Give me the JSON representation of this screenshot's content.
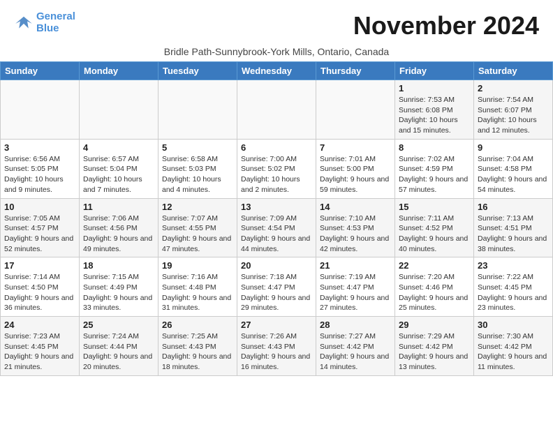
{
  "logo": {
    "text1": "General",
    "text2": "Blue"
  },
  "title": "November 2024",
  "location": "Bridle Path-Sunnybrook-York Mills, Ontario, Canada",
  "weekdays": [
    "Sunday",
    "Monday",
    "Tuesday",
    "Wednesday",
    "Thursday",
    "Friday",
    "Saturday"
  ],
  "weeks": [
    [
      {
        "day": "",
        "info": ""
      },
      {
        "day": "",
        "info": ""
      },
      {
        "day": "",
        "info": ""
      },
      {
        "day": "",
        "info": ""
      },
      {
        "day": "",
        "info": ""
      },
      {
        "day": "1",
        "info": "Sunrise: 7:53 AM\nSunset: 6:08 PM\nDaylight: 10 hours and 15 minutes."
      },
      {
        "day": "2",
        "info": "Sunrise: 7:54 AM\nSunset: 6:07 PM\nDaylight: 10 hours and 12 minutes."
      }
    ],
    [
      {
        "day": "3",
        "info": "Sunrise: 6:56 AM\nSunset: 5:05 PM\nDaylight: 10 hours and 9 minutes."
      },
      {
        "day": "4",
        "info": "Sunrise: 6:57 AM\nSunset: 5:04 PM\nDaylight: 10 hours and 7 minutes."
      },
      {
        "day": "5",
        "info": "Sunrise: 6:58 AM\nSunset: 5:03 PM\nDaylight: 10 hours and 4 minutes."
      },
      {
        "day": "6",
        "info": "Sunrise: 7:00 AM\nSunset: 5:02 PM\nDaylight: 10 hours and 2 minutes."
      },
      {
        "day": "7",
        "info": "Sunrise: 7:01 AM\nSunset: 5:00 PM\nDaylight: 9 hours and 59 minutes."
      },
      {
        "day": "8",
        "info": "Sunrise: 7:02 AM\nSunset: 4:59 PM\nDaylight: 9 hours and 57 minutes."
      },
      {
        "day": "9",
        "info": "Sunrise: 7:04 AM\nSunset: 4:58 PM\nDaylight: 9 hours and 54 minutes."
      }
    ],
    [
      {
        "day": "10",
        "info": "Sunrise: 7:05 AM\nSunset: 4:57 PM\nDaylight: 9 hours and 52 minutes."
      },
      {
        "day": "11",
        "info": "Sunrise: 7:06 AM\nSunset: 4:56 PM\nDaylight: 9 hours and 49 minutes."
      },
      {
        "day": "12",
        "info": "Sunrise: 7:07 AM\nSunset: 4:55 PM\nDaylight: 9 hours and 47 minutes."
      },
      {
        "day": "13",
        "info": "Sunrise: 7:09 AM\nSunset: 4:54 PM\nDaylight: 9 hours and 44 minutes."
      },
      {
        "day": "14",
        "info": "Sunrise: 7:10 AM\nSunset: 4:53 PM\nDaylight: 9 hours and 42 minutes."
      },
      {
        "day": "15",
        "info": "Sunrise: 7:11 AM\nSunset: 4:52 PM\nDaylight: 9 hours and 40 minutes."
      },
      {
        "day": "16",
        "info": "Sunrise: 7:13 AM\nSunset: 4:51 PM\nDaylight: 9 hours and 38 minutes."
      }
    ],
    [
      {
        "day": "17",
        "info": "Sunrise: 7:14 AM\nSunset: 4:50 PM\nDaylight: 9 hours and 36 minutes."
      },
      {
        "day": "18",
        "info": "Sunrise: 7:15 AM\nSunset: 4:49 PM\nDaylight: 9 hours and 33 minutes."
      },
      {
        "day": "19",
        "info": "Sunrise: 7:16 AM\nSunset: 4:48 PM\nDaylight: 9 hours and 31 minutes."
      },
      {
        "day": "20",
        "info": "Sunrise: 7:18 AM\nSunset: 4:47 PM\nDaylight: 9 hours and 29 minutes."
      },
      {
        "day": "21",
        "info": "Sunrise: 7:19 AM\nSunset: 4:47 PM\nDaylight: 9 hours and 27 minutes."
      },
      {
        "day": "22",
        "info": "Sunrise: 7:20 AM\nSunset: 4:46 PM\nDaylight: 9 hours and 25 minutes."
      },
      {
        "day": "23",
        "info": "Sunrise: 7:22 AM\nSunset: 4:45 PM\nDaylight: 9 hours and 23 minutes."
      }
    ],
    [
      {
        "day": "24",
        "info": "Sunrise: 7:23 AM\nSunset: 4:45 PM\nDaylight: 9 hours and 21 minutes."
      },
      {
        "day": "25",
        "info": "Sunrise: 7:24 AM\nSunset: 4:44 PM\nDaylight: 9 hours and 20 minutes."
      },
      {
        "day": "26",
        "info": "Sunrise: 7:25 AM\nSunset: 4:43 PM\nDaylight: 9 hours and 18 minutes."
      },
      {
        "day": "27",
        "info": "Sunrise: 7:26 AM\nSunset: 4:43 PM\nDaylight: 9 hours and 16 minutes."
      },
      {
        "day": "28",
        "info": "Sunrise: 7:27 AM\nSunset: 4:42 PM\nDaylight: 9 hours and 14 minutes."
      },
      {
        "day": "29",
        "info": "Sunrise: 7:29 AM\nSunset: 4:42 PM\nDaylight: 9 hours and 13 minutes."
      },
      {
        "day": "30",
        "info": "Sunrise: 7:30 AM\nSunset: 4:42 PM\nDaylight: 9 hours and 11 minutes."
      }
    ]
  ]
}
